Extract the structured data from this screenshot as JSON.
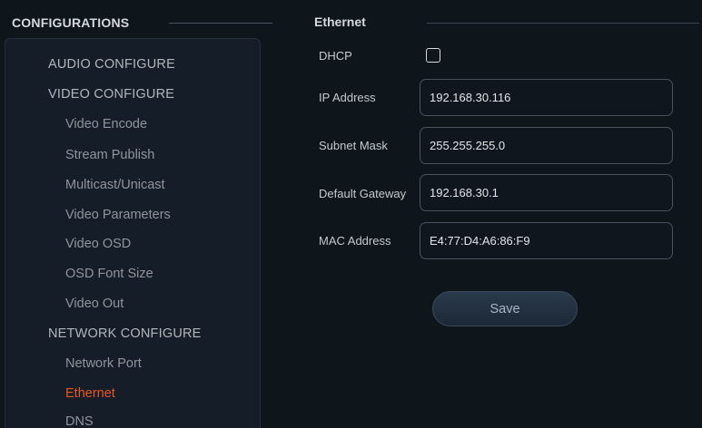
{
  "sidebar": {
    "header": "CONFIGURATIONS",
    "items": [
      {
        "label": "AUDIO CONFIGURE",
        "level": "section"
      },
      {
        "label": "VIDEO CONFIGURE",
        "level": "section"
      },
      {
        "label": "Video Encode",
        "level": "sub"
      },
      {
        "label": "Stream Publish",
        "level": "sub"
      },
      {
        "label": "Multicast/Unicast",
        "level": "sub"
      },
      {
        "label": "Video Parameters",
        "level": "sub"
      },
      {
        "label": "Video OSD",
        "level": "sub"
      },
      {
        "label": "OSD Font Size",
        "level": "sub"
      },
      {
        "label": "Video Out",
        "level": "sub"
      },
      {
        "label": "NETWORK CONFIGURE",
        "level": "section"
      },
      {
        "label": "Network Port",
        "level": "sub"
      },
      {
        "label": "Ethernet",
        "level": "sub",
        "active": true
      },
      {
        "label": "DNS",
        "level": "sub"
      }
    ]
  },
  "main": {
    "header": "Ethernet",
    "dhcp": {
      "label": "DHCP",
      "checked": false
    },
    "fields": [
      {
        "label": "IP Address",
        "value": "192.168.30.116"
      },
      {
        "label": "Subnet Mask",
        "value": "255.255.255.0"
      },
      {
        "label": "Default Gateway",
        "value": "192.168.30.1"
      },
      {
        "label": "MAC Address",
        "value": "E4:77:D4:A6:86:F9"
      }
    ],
    "save_label": "Save"
  },
  "colors": {
    "background": "#0e151b",
    "panel": "#151e28",
    "active_item": "#e8571f",
    "button": "#2a3a4c"
  }
}
